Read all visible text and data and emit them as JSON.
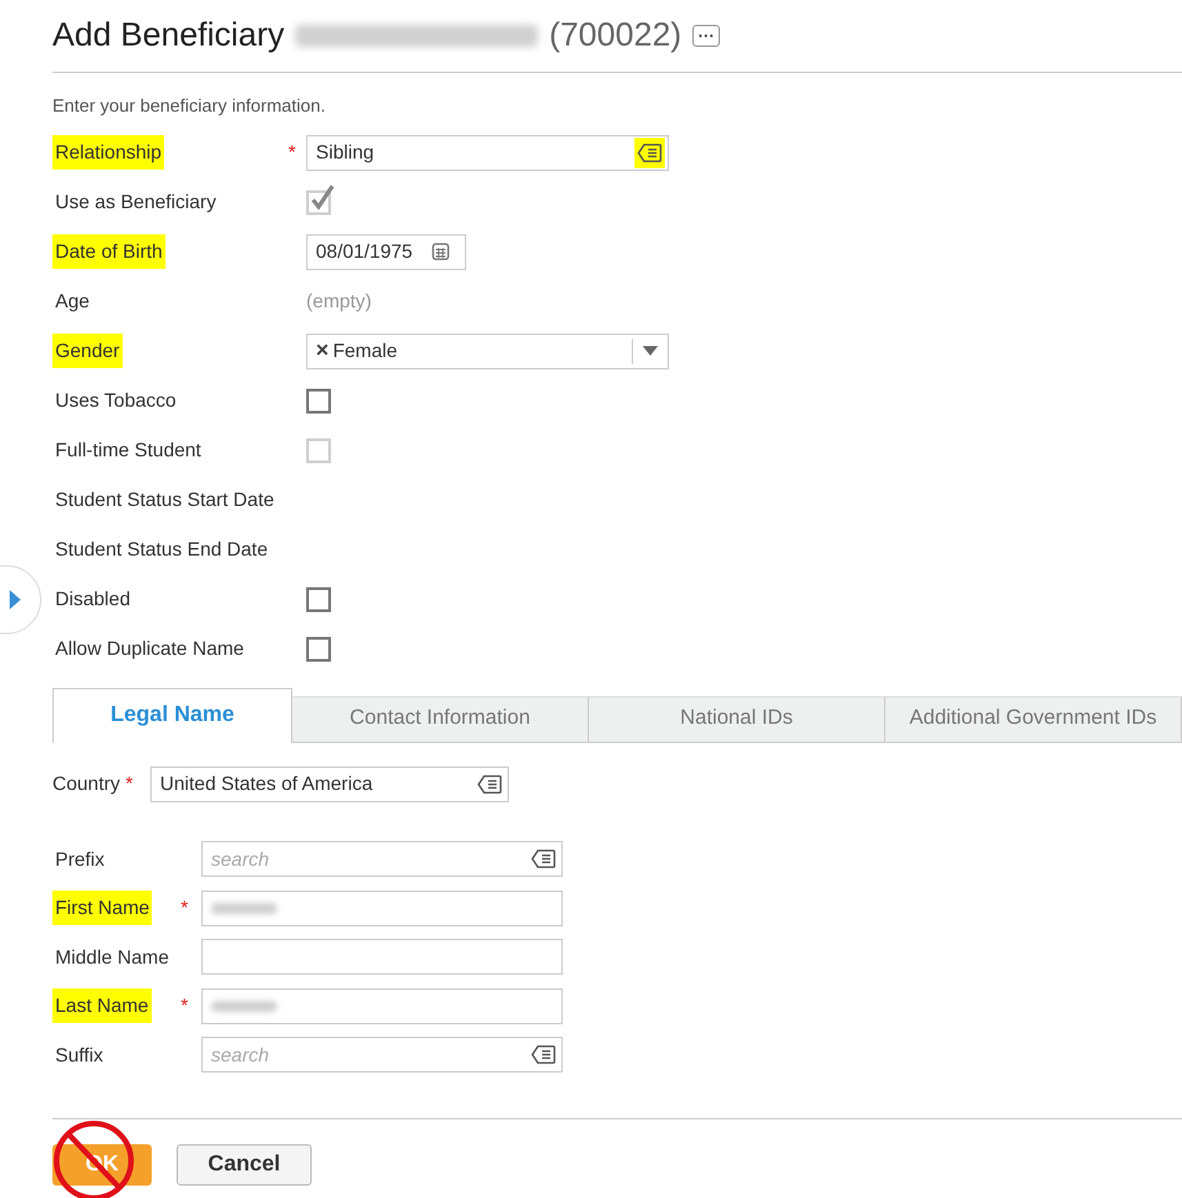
{
  "required_mark": "*",
  "header": {
    "title": "Add Beneficiary",
    "id": "(700022)",
    "name_redacted": true,
    "more": "···"
  },
  "intro": "Enter your beneficiary information.",
  "fields": [
    {
      "label": "Relationship",
      "required": true,
      "highlighted": true,
      "kind": "lookup",
      "value": "Sibling",
      "icon_highlighted": true
    },
    {
      "label": "Use as Beneficiary",
      "required": false,
      "highlighted": false,
      "kind": "checkbox",
      "checked": true,
      "disabled": true
    },
    {
      "label": "Date of Birth",
      "required": false,
      "highlighted": true,
      "kind": "date",
      "value": "08/01/1975"
    },
    {
      "label": "Age",
      "required": false,
      "highlighted": false,
      "kind": "readonly",
      "value": "(empty)"
    },
    {
      "label": "Gender",
      "required": false,
      "highlighted": true,
      "kind": "select",
      "value": "Female",
      "clear": "×"
    },
    {
      "label": "Uses Tobacco",
      "required": false,
      "highlighted": false,
      "kind": "checkbox",
      "checked": false,
      "disabled": false
    },
    {
      "label": "Full-time Student",
      "required": false,
      "highlighted": false,
      "kind": "checkbox",
      "checked": false,
      "disabled": true
    },
    {
      "label": "Student Status Start Date",
      "required": false,
      "highlighted": false,
      "kind": "label"
    },
    {
      "label": "Student Status End Date",
      "required": false,
      "highlighted": false,
      "kind": "label"
    },
    {
      "label": "Disabled",
      "required": false,
      "highlighted": false,
      "kind": "checkbox",
      "checked": false,
      "disabled": false
    },
    {
      "label": "Allow Duplicate Name",
      "required": false,
      "highlighted": false,
      "kind": "checkbox",
      "checked": false,
      "disabled": false
    }
  ],
  "tabs": [
    {
      "label": "Legal Name",
      "selected": true
    },
    {
      "label": "Contact Information",
      "selected": false
    },
    {
      "label": "National IDs",
      "selected": false
    },
    {
      "label": "Additional Government IDs",
      "selected": false
    }
  ],
  "country": {
    "label": "Country",
    "required": true,
    "value": "United States of America"
  },
  "name_fields": [
    {
      "label": "Prefix",
      "required": false,
      "highlighted": false,
      "kind": "lookup",
      "placeholder": "search"
    },
    {
      "label": "First Name",
      "required": true,
      "highlighted": true,
      "kind": "text",
      "redacted": true
    },
    {
      "label": "Middle Name",
      "required": false,
      "highlighted": false,
      "kind": "text",
      "redacted": false
    },
    {
      "label": "Last Name",
      "required": true,
      "highlighted": true,
      "kind": "text",
      "redacted": true
    },
    {
      "label": "Suffix",
      "required": false,
      "highlighted": false,
      "kind": "lookup",
      "placeholder": "search"
    }
  ],
  "buttons": [
    {
      "label": "OK",
      "kind": "primary",
      "crossed_out": true
    },
    {
      "label": "Cancel",
      "kind": "secondary",
      "crossed_out": false
    }
  ]
}
